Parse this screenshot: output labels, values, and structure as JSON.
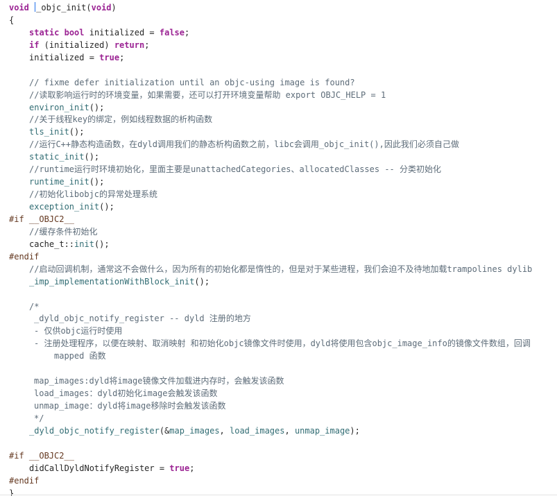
{
  "editor": {
    "lines": [
      {
        "indent": 0,
        "caret_after_first": true,
        "tokens": [
          {
            "t": "void",
            "c": "keyword"
          },
          {
            "t": " ",
            "c": "plain"
          },
          {
            "t": "_objc_init",
            "c": "plain"
          },
          {
            "t": "(",
            "c": "plain"
          },
          {
            "t": "void",
            "c": "keyword"
          },
          {
            "t": ")",
            "c": "plain"
          }
        ]
      },
      {
        "indent": 0,
        "tokens": [
          {
            "t": "{",
            "c": "plain"
          }
        ]
      },
      {
        "indent": 1,
        "tokens": [
          {
            "t": "static",
            "c": "keyword"
          },
          {
            "t": " ",
            "c": "plain"
          },
          {
            "t": "bool",
            "c": "keyword"
          },
          {
            "t": " initialized = ",
            "c": "plain"
          },
          {
            "t": "false",
            "c": "keyword"
          },
          {
            "t": ";",
            "c": "plain"
          }
        ]
      },
      {
        "indent": 1,
        "tokens": [
          {
            "t": "if",
            "c": "keyword"
          },
          {
            "t": " (initialized) ",
            "c": "plain"
          },
          {
            "t": "return",
            "c": "keyword"
          },
          {
            "t": ";",
            "c": "plain"
          }
        ]
      },
      {
        "indent": 1,
        "tokens": [
          {
            "t": "initialized = ",
            "c": "plain"
          },
          {
            "t": "true",
            "c": "keyword"
          },
          {
            "t": ";",
            "c": "plain"
          }
        ]
      },
      {
        "indent": 0,
        "tokens": []
      },
      {
        "indent": 1,
        "tokens": [
          {
            "t": "// fixme defer initialization until an objc-using image is found?",
            "c": "comment"
          }
        ]
      },
      {
        "indent": 1,
        "tokens": [
          {
            "t": "//读取影响运行时的环境变量，如果需要，还可以打开环境变量帮助 export OBJC_HELP = 1",
            "c": "comment"
          }
        ]
      },
      {
        "indent": 1,
        "tokens": [
          {
            "t": "environ_init",
            "c": "func"
          },
          {
            "t": "();",
            "c": "plain"
          }
        ]
      },
      {
        "indent": 1,
        "tokens": [
          {
            "t": "//关于线程key的绑定，例如线程数据的析构函数",
            "c": "comment"
          }
        ]
      },
      {
        "indent": 1,
        "tokens": [
          {
            "t": "tls_init",
            "c": "func"
          },
          {
            "t": "();",
            "c": "plain"
          }
        ]
      },
      {
        "indent": 1,
        "tokens": [
          {
            "t": "//运行C++静态构造函数，在dyld调用我们的静态析构函数之前，libc会调用_objc_init(),因此我们必须自己做",
            "c": "comment"
          }
        ]
      },
      {
        "indent": 1,
        "tokens": [
          {
            "t": "static_init",
            "c": "func"
          },
          {
            "t": "();",
            "c": "plain"
          }
        ]
      },
      {
        "indent": 1,
        "tokens": [
          {
            "t": "//runtime运行时环境初始化，里面主要是unattachedCategories、allocatedClasses -- 分类初始化",
            "c": "comment"
          }
        ]
      },
      {
        "indent": 1,
        "tokens": [
          {
            "t": "runtime_init",
            "c": "func"
          },
          {
            "t": "();",
            "c": "plain"
          }
        ]
      },
      {
        "indent": 1,
        "tokens": [
          {
            "t": "//初始化libobjc的异常处理系统",
            "c": "comment"
          }
        ]
      },
      {
        "indent": 1,
        "tokens": [
          {
            "t": "exception_init",
            "c": "func"
          },
          {
            "t": "();",
            "c": "plain"
          }
        ]
      },
      {
        "indent": 0,
        "tokens": [
          {
            "t": "#if __OBJC2__",
            "c": "preproc"
          }
        ]
      },
      {
        "indent": 1,
        "tokens": [
          {
            "t": "//缓存条件初始化",
            "c": "comment"
          }
        ]
      },
      {
        "indent": 1,
        "tokens": [
          {
            "t": "cache_t",
            "c": "plain"
          },
          {
            "t": "::",
            "c": "plain"
          },
          {
            "t": "init",
            "c": "func"
          },
          {
            "t": "();",
            "c": "plain"
          }
        ]
      },
      {
        "indent": 0,
        "tokens": [
          {
            "t": "#endif",
            "c": "preproc"
          }
        ]
      },
      {
        "indent": 1,
        "tokens": [
          {
            "t": "//启动回调机制，通常这不会做什么，因为所有的初始化都是惰性的，但是对于某些进程，我们会迫不及待地加载trampolines dylib",
            "c": "comment"
          }
        ]
      },
      {
        "indent": 1,
        "tokens": [
          {
            "t": "_imp_implementationWithBlock_init",
            "c": "func"
          },
          {
            "t": "();",
            "c": "plain"
          }
        ]
      },
      {
        "indent": 0,
        "tokens": []
      },
      {
        "indent": 1,
        "tokens": [
          {
            "t": "/*",
            "c": "comment"
          }
        ]
      },
      {
        "indent": 2,
        "tokens": [
          {
            "t": "_dyld_objc_notify_register -- dyld 注册的地方",
            "c": "comment"
          }
        ]
      },
      {
        "indent": 2,
        "tokens": [
          {
            "t": "- 仅供objc运行时使用",
            "c": "comment"
          }
        ]
      },
      {
        "indent": 2,
        "tokens": [
          {
            "t": "- 注册处理程序，以便在映射、取消映射 和初始化objc镜像文件时使用，dyld将使用包含objc_image_info的镜像文件数组，回调",
            "c": "comment"
          }
        ]
      },
      {
        "indent": 3,
        "tokens": [
          {
            "t": "mapped 函数",
            "c": "comment"
          }
        ]
      },
      {
        "indent": 0,
        "tokens": []
      },
      {
        "indent": 2,
        "tokens": [
          {
            "t": "map_images:dyld将image镜像文件加载进内存时，会触发该函数",
            "c": "comment"
          }
        ]
      },
      {
        "indent": 2,
        "tokens": [
          {
            "t": "load_images：dyld初始化image会触发该函数",
            "c": "comment"
          }
        ]
      },
      {
        "indent": 2,
        "tokens": [
          {
            "t": "unmap_image：dyld将image移除时会触发该函数",
            "c": "comment"
          }
        ]
      },
      {
        "indent": 2,
        "tokens": [
          {
            "t": "*/",
            "c": "comment"
          }
        ]
      },
      {
        "indent": 1,
        "tokens": [
          {
            "t": "_dyld_objc_notify_register",
            "c": "func"
          },
          {
            "t": "(&",
            "c": "plain"
          },
          {
            "t": "map_images",
            "c": "func"
          },
          {
            "t": ", ",
            "c": "plain"
          },
          {
            "t": "load_images",
            "c": "func"
          },
          {
            "t": ", ",
            "c": "plain"
          },
          {
            "t": "unmap_image",
            "c": "func"
          },
          {
            "t": ");",
            "c": "plain"
          }
        ]
      },
      {
        "indent": 0,
        "tokens": []
      },
      {
        "indent": 0,
        "tokens": [
          {
            "t": "#if __OBJC2__",
            "c": "preproc"
          }
        ]
      },
      {
        "indent": 1,
        "tokens": [
          {
            "t": "didCallDyldNotifyRegister = ",
            "c": "plain"
          },
          {
            "t": "true",
            "c": "keyword"
          },
          {
            "t": ";",
            "c": "plain"
          }
        ]
      },
      {
        "indent": 0,
        "tokens": [
          {
            "t": "#endif",
            "c": "preproc"
          }
        ]
      },
      {
        "indent": 0,
        "tokens": [
          {
            "t": "}",
            "c": "plain"
          }
        ]
      }
    ]
  },
  "colors": {
    "keyword": "#9b2393",
    "comment": "#5d6c79",
    "preprocessor": "#643820",
    "function": "#326d74",
    "plain": "#262626",
    "caret": "#1f6feb",
    "background": "#ffffff"
  }
}
